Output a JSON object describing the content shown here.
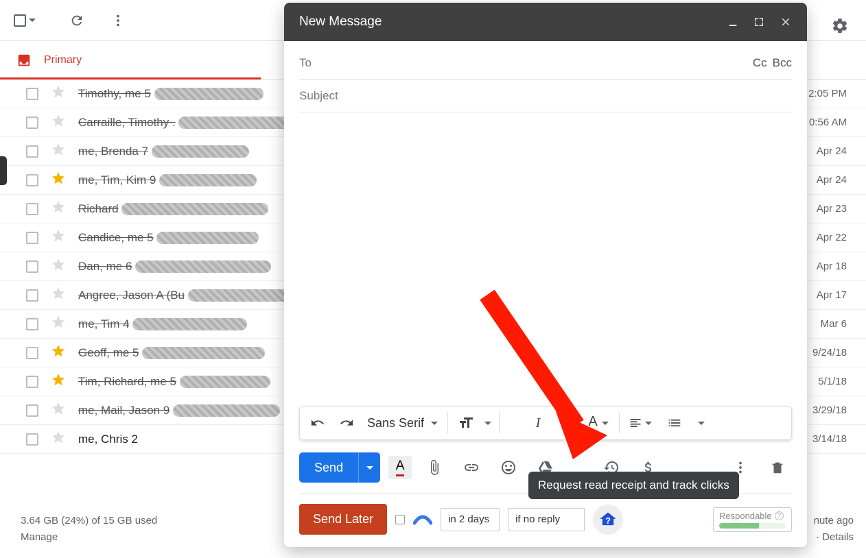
{
  "toolbar": {},
  "tab": {
    "label": "Primary"
  },
  "emails": [
    {
      "sender": "Timothy, me 5",
      "redacted": true,
      "starred": false,
      "date": "2:05 PM"
    },
    {
      "sender": "Carraille, Timothy .",
      "redacted": true,
      "starred": false,
      "date": "0:56 AM"
    },
    {
      "sender": "me, Brenda 7",
      "redacted": true,
      "starred": false,
      "date": "Apr 24"
    },
    {
      "sender": "me, Tim, Kim 9",
      "redacted": true,
      "starred": true,
      "date": "Apr 24"
    },
    {
      "sender": "Richard",
      "redacted": true,
      "starred": false,
      "date": "Apr 23"
    },
    {
      "sender": "Candice, me 5",
      "redacted": true,
      "starred": false,
      "date": "Apr 22"
    },
    {
      "sender": "Dan, me 6",
      "redacted": true,
      "starred": false,
      "date": "Apr 18"
    },
    {
      "sender": "Angree, Jason A (Bu",
      "redacted": true,
      "starred": false,
      "date": "Apr 17"
    },
    {
      "sender": "me, Tim 4",
      "redacted": true,
      "starred": false,
      "date": "Mar 6"
    },
    {
      "sender": "Geoff, me 5",
      "redacted": true,
      "starred": true,
      "date": "9/24/18"
    },
    {
      "sender": "Tim, Richard, me 5",
      "redacted": true,
      "starred": true,
      "date": "5/1/18"
    },
    {
      "sender": "me, Mail, Jason 9",
      "redacted": true,
      "starred": false,
      "date": "3/29/18"
    },
    {
      "sender": "me, Chris 2",
      "redacted": false,
      "starred": false,
      "date": "3/14/18"
    }
  ],
  "storage": {
    "line1": "3.64 GB (24%) of 15 GB used",
    "line2": "Manage"
  },
  "footer": {
    "line1": "nute ago",
    "line2": "· Details"
  },
  "compose": {
    "title": "New Message",
    "to_label": "To",
    "cc_label": "Cc",
    "bcc_label": "Bcc",
    "subject_label": "Subject",
    "font_name": "Sans Serif",
    "send_label": "Send",
    "send_later_label": "Send Later",
    "in_days_value": "in 2 days",
    "if_no_reply_value": "if no reply",
    "respondable_label": "Respondable"
  },
  "tooltip": {
    "text": "Request read receipt and track clicks"
  }
}
